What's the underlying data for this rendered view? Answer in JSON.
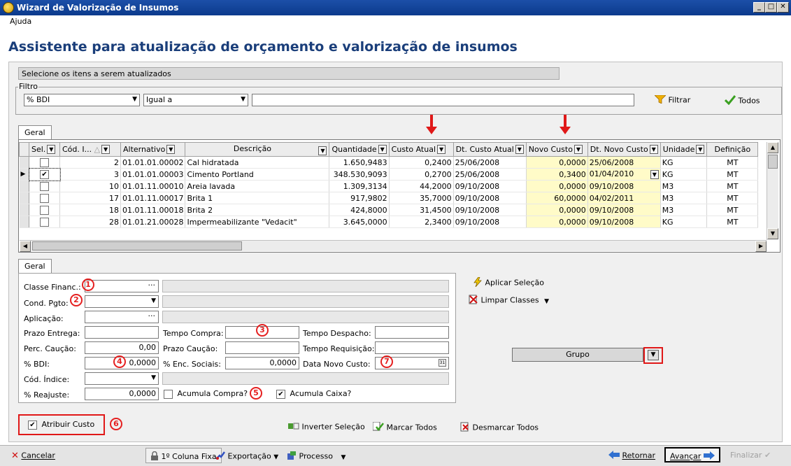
{
  "window": {
    "title": "Wizard de Valorização de Insumos"
  },
  "menu": {
    "help": "Ajuda"
  },
  "page": {
    "title": "Assistente para atualização de orçamento e valorização de insumos",
    "section": "Selecione os itens a serem atualizados"
  },
  "filter": {
    "label": "Filtro",
    "field": "% BDI",
    "operator": "Igual a",
    "value": "",
    "filter_button": "Filtrar",
    "all_button": "Todos"
  },
  "tabs": {
    "grid_tab": "Geral",
    "form_tab": "Geral"
  },
  "grid": {
    "columns": [
      "Sel.",
      "Cód. I...",
      "Alternativo",
      "Descrição",
      "Quantidade",
      "Custo Atual",
      "Dt. Custo Atual",
      "Novo Custo",
      "Dt. Novo Custo",
      "Unidade",
      "Definição"
    ],
    "rows": [
      {
        "sel": "",
        "cod": "2",
        "alt": "01.01.01.00002",
        "desc": "Cal hidratada",
        "qty": "1.650,9483",
        "cost": "0,2400",
        "cost_date": "25/06/2008",
        "new_cost": "0,0000",
        "new_date": "25/06/2008",
        "unit": "KG",
        "def": "MT"
      },
      {
        "sel": "✔",
        "cod": "3",
        "alt": "01.01.01.00003",
        "desc": "Cimento Portland",
        "qty": "348.530,9093",
        "cost": "0,2700",
        "cost_date": "25/06/2008",
        "new_cost": "0,3400",
        "new_date": "01/04/2010",
        "unit": "KG",
        "def": "MT"
      },
      {
        "sel": "",
        "cod": "10",
        "alt": "01.01.11.00010",
        "desc": "Areia lavada",
        "qty": "1.309,3134",
        "cost": "44,2000",
        "cost_date": "09/10/2008",
        "new_cost": "0,0000",
        "new_date": "09/10/2008",
        "unit": "M3",
        "def": "MT"
      },
      {
        "sel": "",
        "cod": "17",
        "alt": "01.01.11.00017",
        "desc": "Brita 1",
        "qty": "917,9802",
        "cost": "35,7000",
        "cost_date": "09/10/2008",
        "new_cost": "60,0000",
        "new_date": "04/02/2011",
        "unit": "M3",
        "def": "MT"
      },
      {
        "sel": "",
        "cod": "18",
        "alt": "01.01.11.00018",
        "desc": "Brita 2",
        "qty": "424,8000",
        "cost": "31,4500",
        "cost_date": "09/10/2008",
        "new_cost": "0,0000",
        "new_date": "09/10/2008",
        "unit": "M3",
        "def": "MT"
      },
      {
        "sel": "",
        "cod": "28",
        "alt": "01.01.21.00028",
        "desc": "Impermeabilizante \"Vedacit\"",
        "qty": "3.645,0000",
        "cost": "2,3400",
        "cost_date": "09/10/2008",
        "new_cost": "0,0000",
        "new_date": "09/10/2008",
        "unit": "KG",
        "def": "MT"
      }
    ]
  },
  "form": {
    "classe_label": "Classe Financ.:",
    "classe_value": "",
    "cond_label": "Cond. Pgto:",
    "cond_value": "",
    "aplicacao_label": "Aplicação:",
    "aplicacao_value": "",
    "prazo_entrega_label": "Prazo Entrega:",
    "tempo_compra_label": "Tempo Compra:",
    "tempo_despacho_label": "Tempo Despacho:",
    "perc_caucao_label": "Perc. Caução:",
    "perc_caucao_value": "0,00",
    "prazo_caucao_label": "Prazo Caução:",
    "tempo_requisicao_label": "Tempo Requisição:",
    "bdi_label": "% BDI:",
    "bdi_value": "0,0000",
    "enc_sociais_label": "% Enc. Sociais:",
    "enc_sociais_value": "0,0000",
    "data_novo_custo_label": "Data Novo Custo:",
    "cod_indice_label": "Cód. Índice:",
    "reajuste_label": "% Reajuste:",
    "reajuste_value": "0,0000",
    "acumula_compra_label": "Acumula Compra?",
    "acumula_caixa_label": "Acumula Caixa?",
    "atribuir_custo_label": "Atribuir Custo"
  },
  "markers": [
    "1",
    "2",
    "3",
    "4",
    "5",
    "6",
    "7"
  ],
  "side_actions": {
    "apply_selection": "Aplicar Seleção",
    "clear_classes": "Limpar Classes",
    "group": "Grupo"
  },
  "selection_actions": {
    "invert": "Inverter Seleção",
    "mark_all": "Marcar Todos",
    "unmark_all": "Desmarcar Todos"
  },
  "bottom": {
    "cancel": "Cancelar",
    "fixed_col": "1º Coluna Fixa",
    "export": "Exportação",
    "process": "Processo",
    "back": "Retornar",
    "next": "Avançar",
    "finish": "Finalizar"
  },
  "colors": {
    "highlight": "#fffbc8",
    "title_blue": "#1a3e7a",
    "marker_red": "#e52020"
  }
}
